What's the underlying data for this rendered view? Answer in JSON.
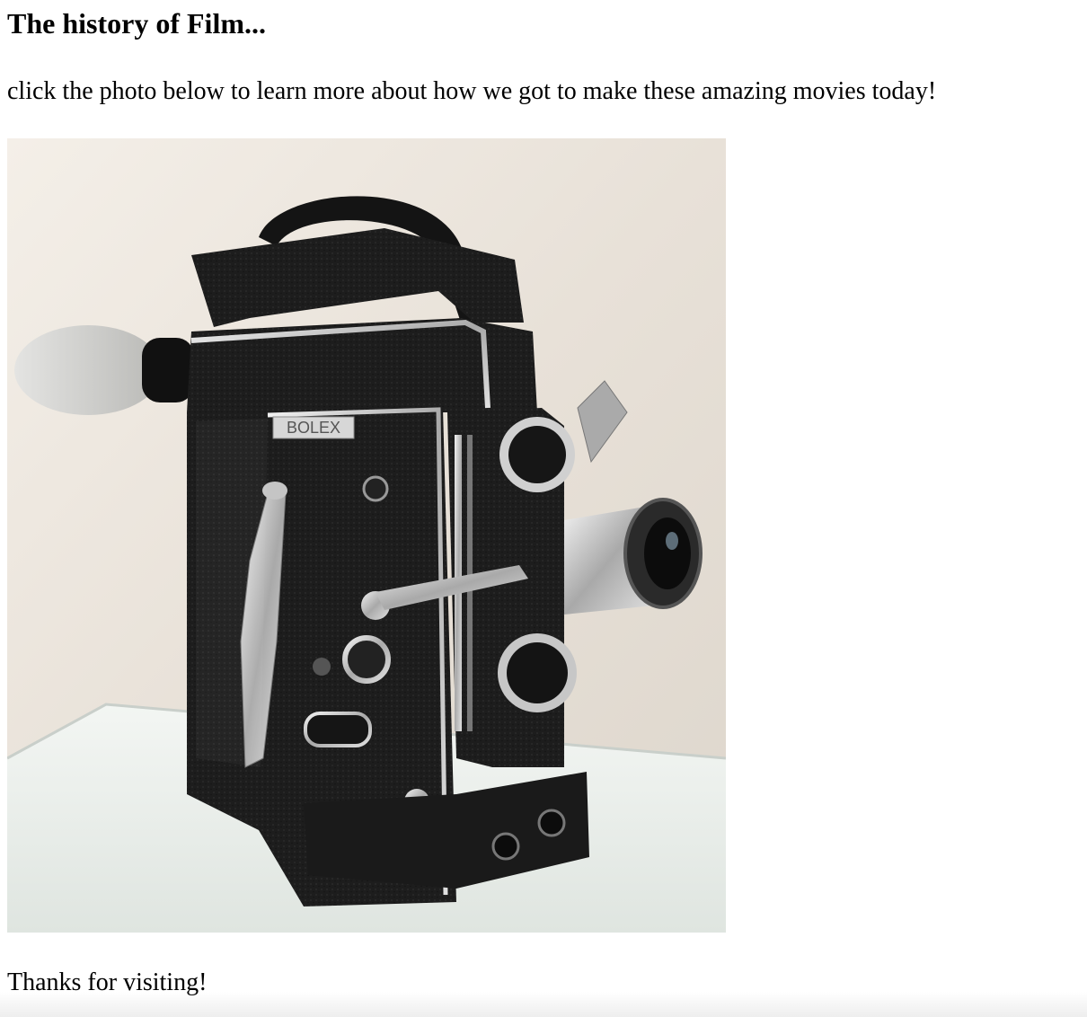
{
  "page": {
    "heading": "The history of Film...",
    "intro": "click the photo below to learn more about how we got to make these amazing movies today!",
    "footer_text": "Thanks for visiting!"
  },
  "photo": {
    "alt": "Vintage Bolex H16 16mm film camera",
    "brand_lettering": "BOLEX"
  },
  "colors": {
    "text": "#000000",
    "background": "#ffffff",
    "camera_body": "#1c1c1c",
    "chrome": "#c8c8c8",
    "wall": "#efe9e2",
    "table": "#e9eeea"
  }
}
